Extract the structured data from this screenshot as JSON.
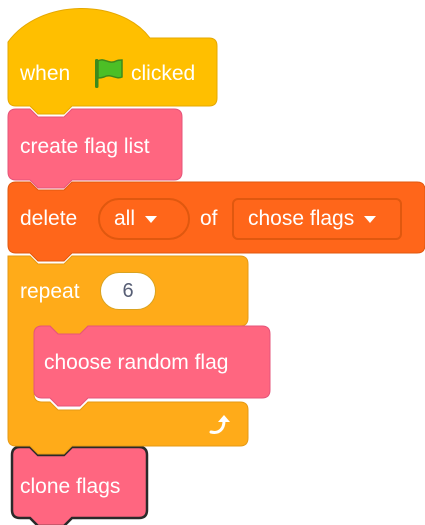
{
  "script": {
    "hat_block": {
      "when_label": "when",
      "flag_icon": "green-flag-icon",
      "clicked_label": "clicked",
      "color": "#ffbf00"
    },
    "create_list_block": {
      "label": "create flag list",
      "color": "#ff6680"
    },
    "delete_block": {
      "label": "delete",
      "index_value": "all",
      "of_label": "of",
      "list_value": "chose flags",
      "color": "#ff661a"
    },
    "repeat_block": {
      "label": "repeat",
      "count": "6",
      "arrow_icon": "loop-arrow-icon",
      "color": "#ffab19"
    },
    "choose_block": {
      "label": "choose random flag",
      "color": "#ff6680"
    },
    "clone_block": {
      "label": "clone flags",
      "color": "#ff6680",
      "selected": true
    }
  }
}
